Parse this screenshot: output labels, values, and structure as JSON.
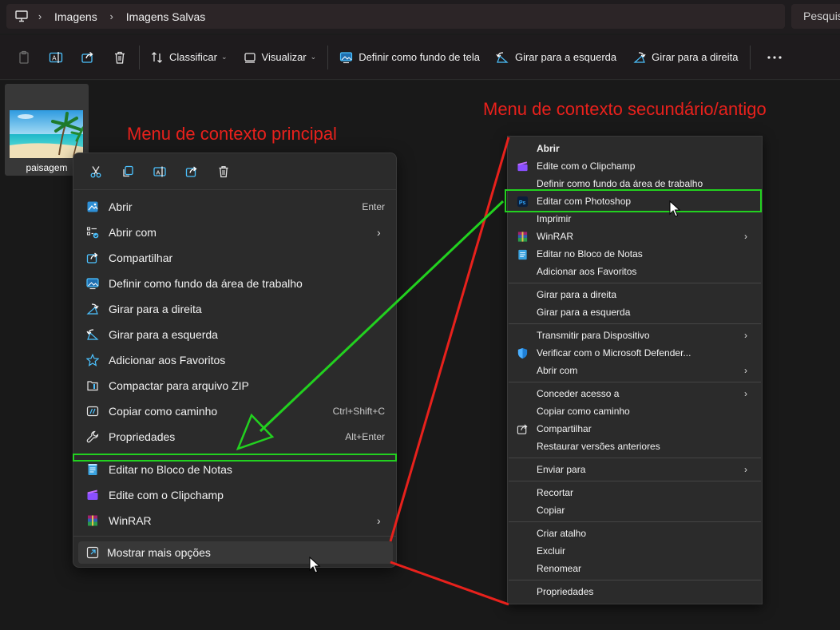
{
  "breadcrumb": {
    "items": [
      "Imagens",
      "Imagens Salvas"
    ]
  },
  "search": {
    "placeholder": "Pesquisar"
  },
  "toolbar": {
    "sort_label": "Classificar",
    "view_label": "Visualizar",
    "set_background_label": "Definir como fundo de tela",
    "rotate_left_label": "Girar para a esquerda",
    "rotate_right_label": "Girar para a direita"
  },
  "file": {
    "name": "paisagem"
  },
  "annotations": {
    "primary": "Menu de contexto principal",
    "secondary": "Menu de contexto secundário/antigo"
  },
  "context_menu": {
    "items": [
      {
        "label": "Abrir",
        "shortcut": "Enter"
      },
      {
        "label": "Abrir com",
        "shortcut": ""
      },
      {
        "label": "Compartilhar",
        "shortcut": ""
      },
      {
        "label": "Definir como fundo da área de trabalho",
        "shortcut": ""
      },
      {
        "label": "Girar para a direita",
        "shortcut": ""
      },
      {
        "label": "Girar para a esquerda",
        "shortcut": ""
      },
      {
        "label": "Adicionar aos Favoritos",
        "shortcut": ""
      },
      {
        "label": "Compactar para arquivo ZIP",
        "shortcut": ""
      },
      {
        "label": "Copiar como caminho",
        "shortcut": "Ctrl+Shift+C"
      },
      {
        "label": "Propriedades",
        "shortcut": "Alt+Enter"
      }
    ],
    "extra_items": [
      {
        "label": "Editar no Bloco de Notas"
      },
      {
        "label": "Edite com o Clipchamp"
      },
      {
        "label": "WinRAR"
      }
    ],
    "more_options": "Mostrar mais opções"
  },
  "classic_menu": {
    "items": [
      {
        "label": "Abrir"
      },
      {
        "label": "Edite com o Clipchamp"
      },
      {
        "label": "Definir como fundo da área de trabalho"
      },
      {
        "label": "Editar com Photoshop"
      },
      {
        "label": "Imprimir"
      },
      {
        "label": "WinRAR"
      },
      {
        "label": "Editar no Bloco de Notas"
      },
      {
        "label": "Adicionar aos Favoritos"
      },
      {
        "label": "Girar para a direita"
      },
      {
        "label": "Girar para a esquerda"
      },
      {
        "label": "Transmitir para Dispositivo"
      },
      {
        "label": "Verificar com o Microsoft Defender..."
      },
      {
        "label": "Abrir com"
      },
      {
        "label": "Conceder acesso a"
      },
      {
        "label": "Copiar como caminho"
      },
      {
        "label": "Compartilhar"
      },
      {
        "label": "Restaurar versões anteriores"
      },
      {
        "label": "Enviar para"
      },
      {
        "label": "Recortar"
      },
      {
        "label": "Copiar"
      },
      {
        "label": "Criar atalho"
      },
      {
        "label": "Excluir"
      },
      {
        "label": "Renomear"
      },
      {
        "label": "Propriedades"
      }
    ]
  },
  "colors": {
    "annotation_red": "#e8211c",
    "highlight_green": "#22d11f",
    "accent_blue": "#4cc2ff"
  },
  "icons": {
    "toolbar": [
      "paste-icon",
      "rename-icon",
      "share-icon",
      "delete-icon",
      "sort-icon",
      "view-icon",
      "wallpaper-icon",
      "rotate-left-icon",
      "rotate-right-icon",
      "more-icon"
    ],
    "quick_actions": [
      "cut-icon",
      "copy-icon",
      "rename-icon",
      "share-icon",
      "delete-icon"
    ]
  }
}
